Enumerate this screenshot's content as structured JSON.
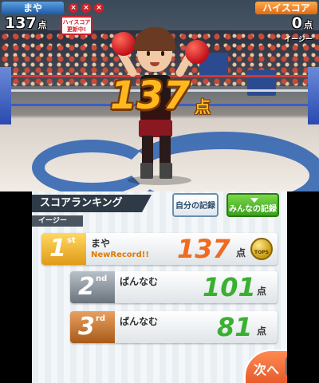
{
  "hud": {
    "player_name": "まや",
    "player_score": "137",
    "score_unit": "点",
    "highscore_badge": "ハイスコア更新中!",
    "miss_icons": [
      "×",
      "×",
      "×"
    ],
    "highscore_label": "ハイスコア",
    "highscore_value": "0",
    "difficulty": "イージー"
  },
  "center_score": {
    "value": "137",
    "unit": "点"
  },
  "ranking": {
    "title": "スコアランキング",
    "mine_button": "自分の記録",
    "all_button": "みんなの記録",
    "difficulty": "イージー",
    "coin_label": "TOPS",
    "entries": [
      {
        "rank": "1",
        "suffix": "st",
        "name": "まや",
        "note": "NewRecord!!",
        "score": "137",
        "unit": "点"
      },
      {
        "rank": "2",
        "suffix": "nd",
        "name": "ばんなむ",
        "note": "",
        "score": "101",
        "unit": "点"
      },
      {
        "rank": "3",
        "suffix": "rd",
        "name": "ばんなむ",
        "note": "",
        "score": "81",
        "unit": "点"
      }
    ],
    "next_button": "次へ",
    "site_logo": "G"
  }
}
